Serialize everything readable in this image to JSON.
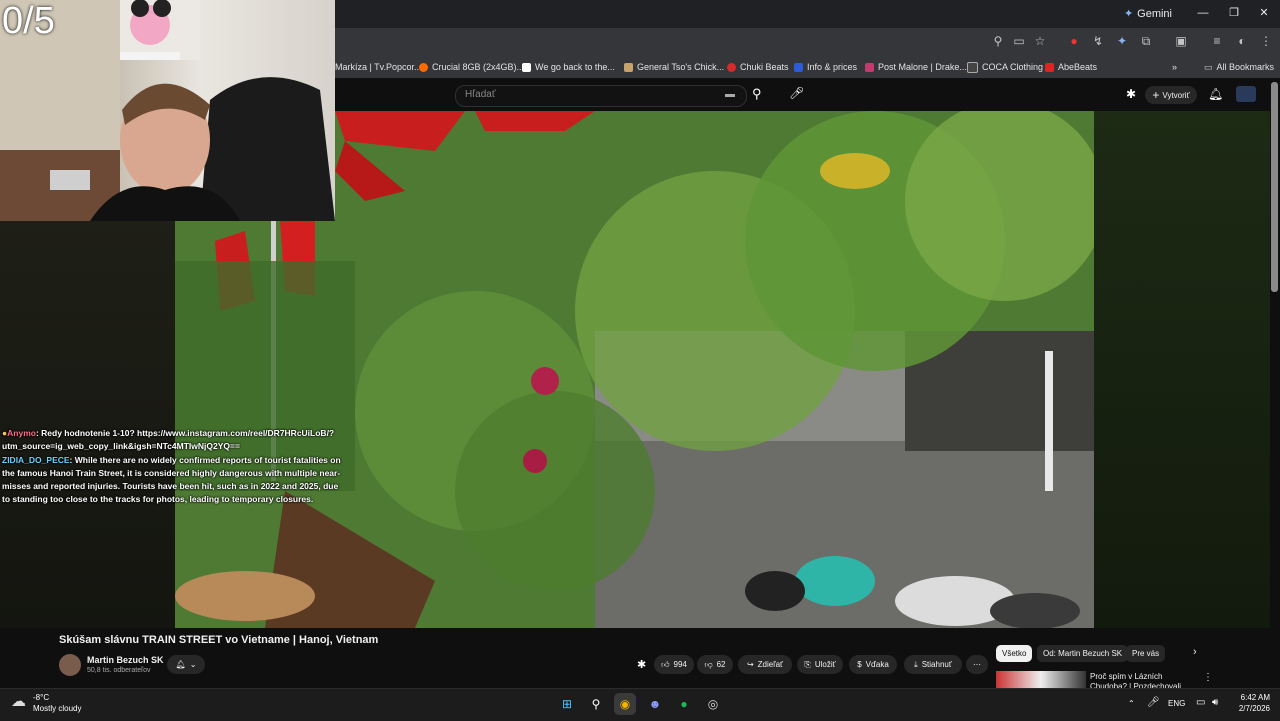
{
  "counter": "0/5",
  "browser": {
    "gemini_label": "Gemini",
    "bookmarks": [
      {
        "label": "Markíza | Tv.Popcor...",
        "color": "#e84b3a"
      },
      {
        "label": "Crucial 8GB (2x4GB)...",
        "color": "#ff6a00"
      },
      {
        "label": "We go back to the...",
        "color": "#ffffff"
      },
      {
        "label": "General Tso's Chick...",
        "color": "#c7a36b"
      },
      {
        "label": "Chuki Beats",
        "color": "#d52b2b"
      },
      {
        "label": "Info & prices",
        "color": "#2d5bd7"
      },
      {
        "label": "Post Malone | Drake...",
        "color": "#c43a6e"
      },
      {
        "label": "COCA Clothing",
        "color": "#444444"
      },
      {
        "label": "AbeBeats",
        "color": "#e02424"
      }
    ],
    "all_bookmarks": "All Bookmarks"
  },
  "youtube": {
    "search_placeholder": "Hľadať",
    "create_label": "Vytvoriť"
  },
  "chat": [
    {
      "user": "Anymo",
      "text": ": Redy hodnotenie 1-10? https://www.instagram.com/reel/DR7HRcUiLoB/?utm_source=ig_web_copy_link&igsh=NTc4MTIwNjQ2YQ=="
    },
    {
      "user": "ZIDIA_DO_PECE",
      "text": ": While there are no widely confirmed reports of tourist fatalities on the famous Hanoi Train Street, it is considered highly dangerous with multiple near-misses and reported injuries. Tourists have been hit, such as in 2022 and 2025, due to standing too close to the tracks for photos, leading to temporary closures."
    }
  ],
  "video": {
    "title": "Skúšam slávnu TRAIN STREET vo Vietname | Hanoj, Vietnam",
    "channel": "Martin Bezuch SK",
    "subscribers": "50,8 tis. odberateľov",
    "likes": "994",
    "dislikes": "62",
    "share": "Zdieľať",
    "save": "Uložiť",
    "thanks": "Vďaka",
    "download": "Stiahnuť"
  },
  "chips": [
    "Všetko",
    "Od: Martin Bezuch SK",
    "Pre vás"
  ],
  "recommendation": {
    "title": "Proč spím v Lázních Chudoba? | Pozdechovali jsme v Praze"
  },
  "taskbar": {
    "temperature": "-8°C",
    "weather": "Mostly cloudy",
    "lang": "ENG",
    "time": "6:42 AM",
    "date": "2/7/2026"
  },
  "colors": {
    "accent": "#ff0000",
    "background": "#0f0f0f"
  }
}
